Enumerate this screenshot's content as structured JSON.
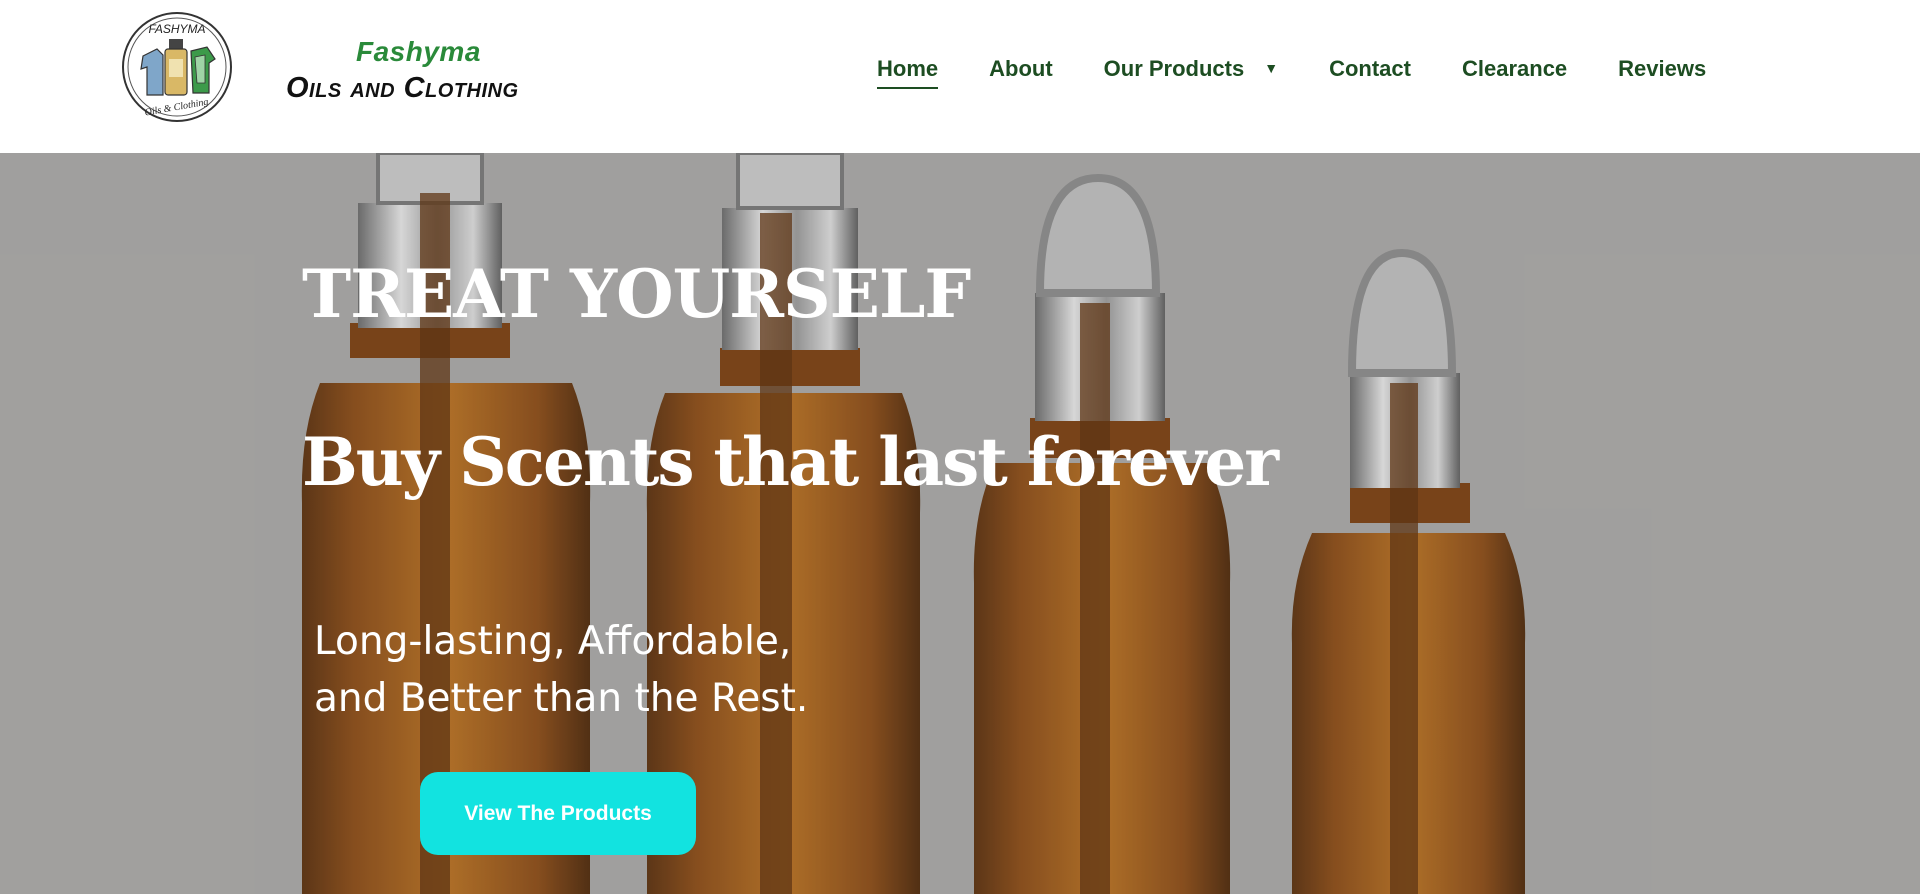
{
  "brand": {
    "badge_text_top": "FASHYMA",
    "badge_text_bottom": "Oils & Clothing",
    "name_top": "Fashyma",
    "name_bottom": "Oils and Clothing",
    "accent_color": "#2a8a3a"
  },
  "nav": {
    "items": [
      {
        "label": "Home",
        "active": true
      },
      {
        "label": "About"
      },
      {
        "label": "Our Products",
        "icon": "caret-down-icon"
      },
      {
        "label": "Contact"
      },
      {
        "label": "Clearance"
      },
      {
        "label": "Reviews"
      }
    ],
    "color": "#1d4d22"
  },
  "hero": {
    "title": "TREAT YOURSELF",
    "heading": "Buy Scents that last forever",
    "subtitle_line1": "Long-lasting, Affordable,",
    "subtitle_line2": "and Better than the Rest.",
    "cta_label": "View The Products",
    "cta_color": "#12e3e0",
    "background_image": "amber-dropper-bottles"
  }
}
